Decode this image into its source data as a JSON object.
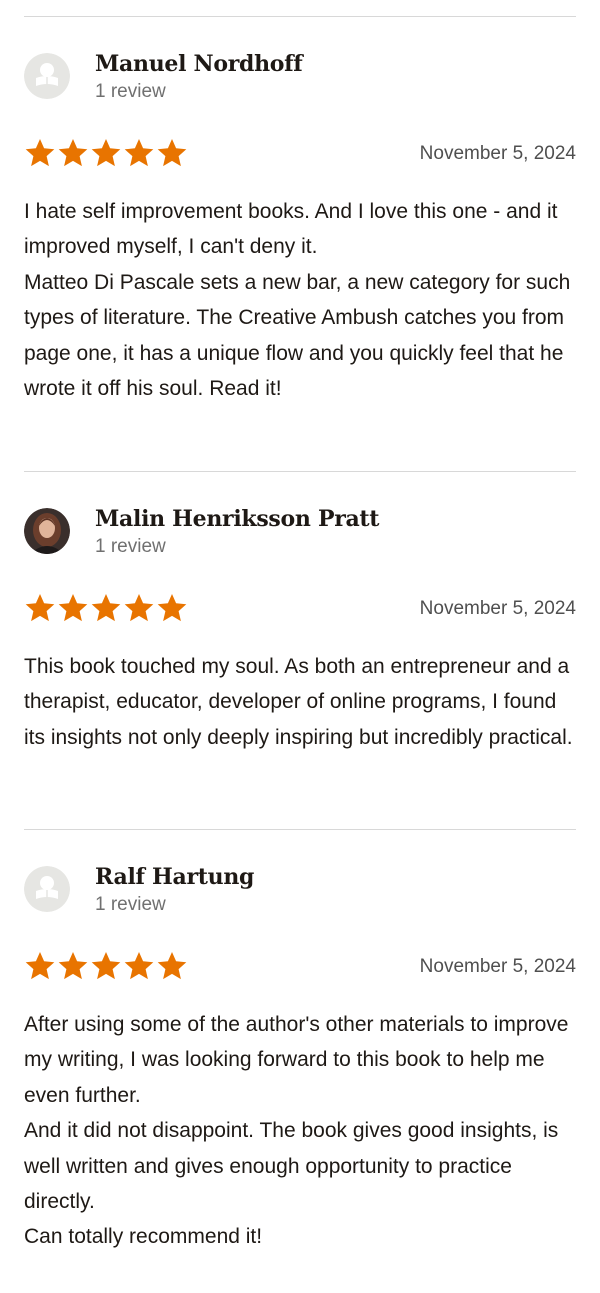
{
  "colors": {
    "star": "#e87400",
    "divider": "#d8d8d8",
    "muted_text": "#707070"
  },
  "reviews": [
    {
      "reviewer": {
        "name": "Manuel Nordhoff",
        "review_count": "1 review",
        "avatar": "default-reader-avatar"
      },
      "rating": 5,
      "date": "November 5, 2024",
      "body": [
        "I hate self improvement books. And I love this one - and it improved myself, I can't deny it.",
        "Matteo Di Pascale sets a new bar, a new category for such types of literature. The Creative Ambush catches you from page one, it has a unique flow and you quickly feel that he wrote it off his soul. Read it!"
      ]
    },
    {
      "reviewer": {
        "name": "Malin Henriksson Pratt",
        "review_count": "1 review",
        "avatar": "profile-photo"
      },
      "rating": 5,
      "date": "November 5, 2024",
      "body": [
        "This book touched my soul. As both an entrepreneur and a therapist, educator, developer of online programs, I found its insights not only deeply inspiring but incredibly practical."
      ]
    },
    {
      "reviewer": {
        "name": "Ralf Hartung",
        "review_count": "1 review",
        "avatar": "default-reader-avatar"
      },
      "rating": 5,
      "date": "November 5, 2024",
      "body": [
        "After using some of the author's other materials to improve my writing, I was looking forward to this book to help me even further.",
        "And it did not disappoint. The book gives good insights, is well written and gives enough opportunity to practice directly.",
        "Can totally recommend it!"
      ]
    }
  ]
}
